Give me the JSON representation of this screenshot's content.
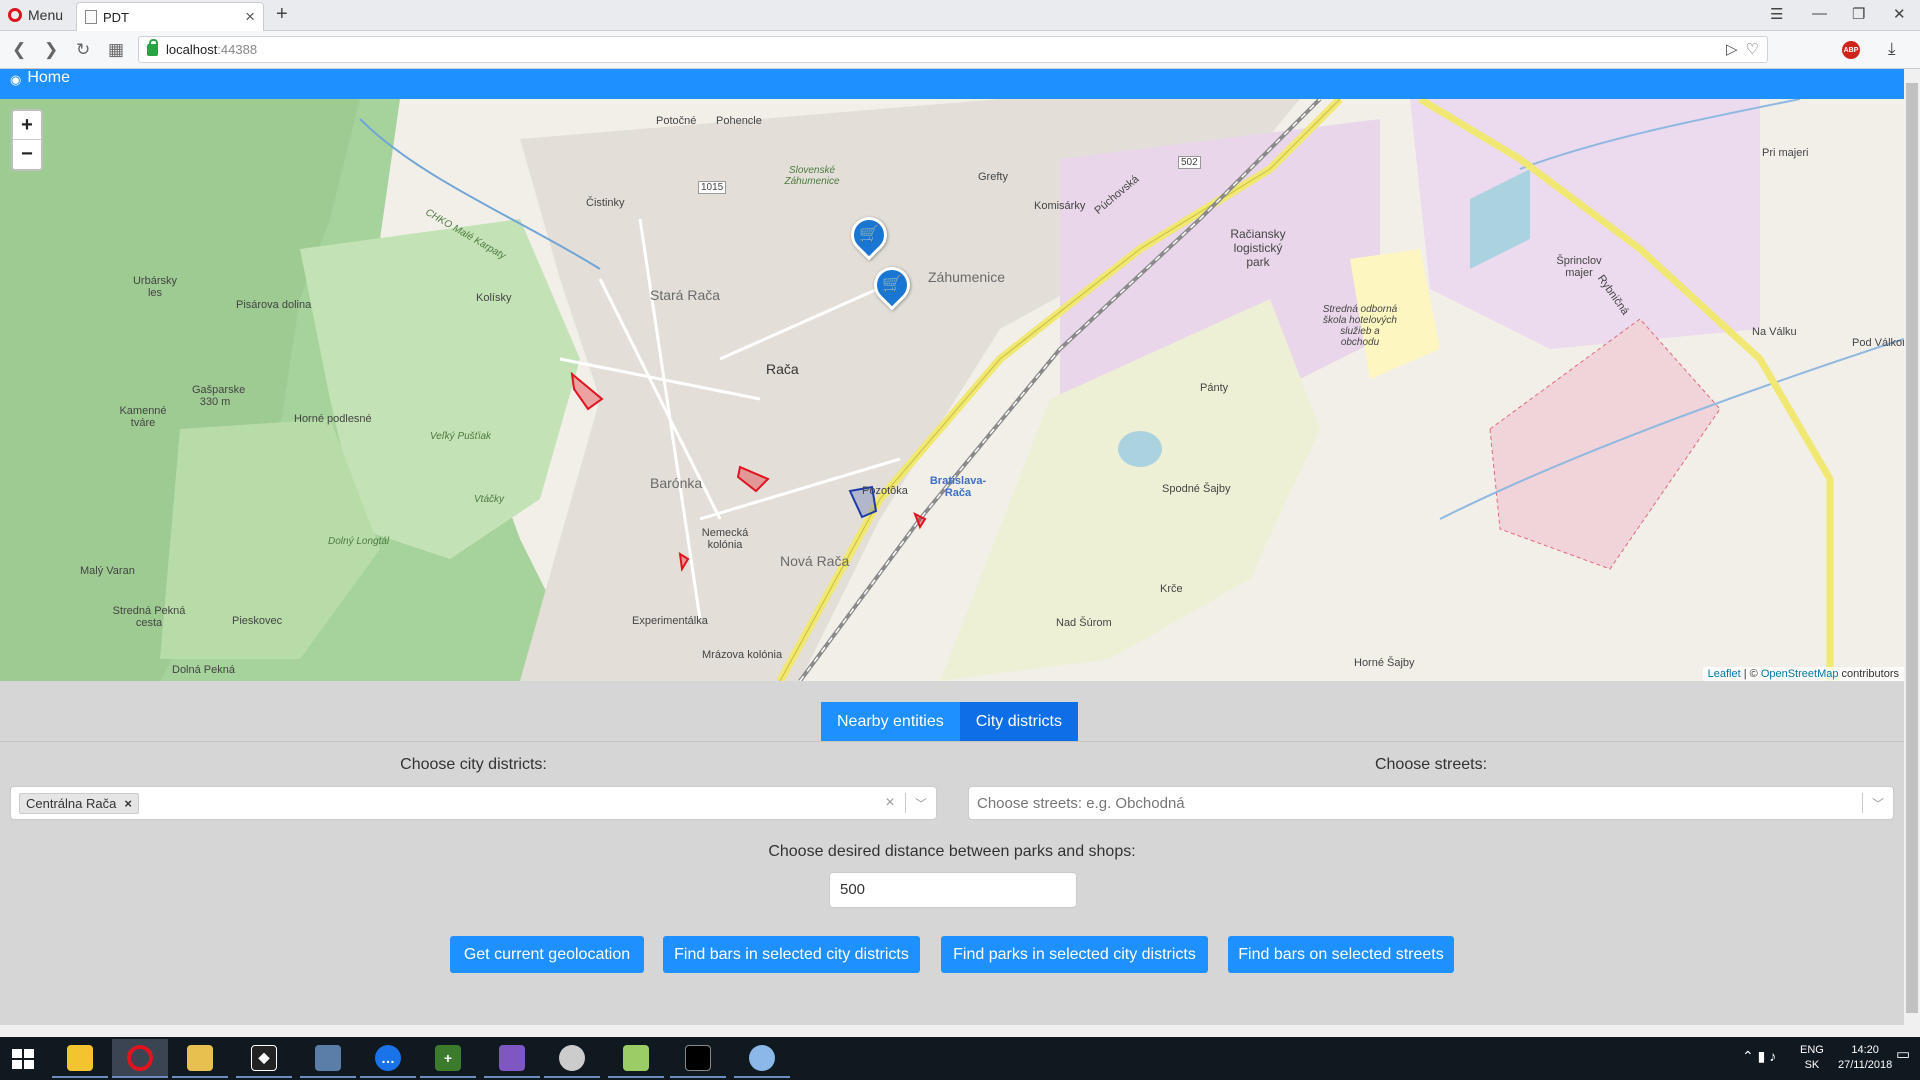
{
  "browser": {
    "menu_label": "Menu",
    "tab_title": "PDT",
    "url_host": "localhost",
    "url_port": ":44388",
    "abp_label": "ABP"
  },
  "app": {
    "home_label": "Home"
  },
  "map": {
    "zoom_in": "+",
    "zoom_out": "−",
    "attribution": {
      "leaflet": "Leaflet",
      "sep": " | © ",
      "osm": "OpenStreetMap",
      "suffix": " contributors"
    },
    "labels": {
      "raca": "Rača",
      "stara_raca": "Stará Rača",
      "baronka": "Barónka",
      "nova_raca": "Nová Rača",
      "zahumenice": "Záhumenice",
      "bratislava_raca": "Bratislava-Rača",
      "pozotoka": "Pozotôka",
      "kolisky": "Kolísky",
      "urbarsky_les": "Urbársky les",
      "pisarova_dolina": "Pisárova dolina",
      "gasparske": "Gašparske 330 m",
      "kamenne_tvare": "Kamenné tváre",
      "horne_podlesne": "Horné podlesné",
      "maly_varan": "Malý Varan",
      "stredna_pekna_cesta": "Stredná Pekná cesta",
      "pieskovec": "Pieskovec",
      "dolna_pekna": "Dolná Pekná",
      "vtacky": "Vtáčky",
      "velky_pustiak": "Veľký Pušťiak",
      "dolny_longtal": "Dolný Longtál",
      "potocne": "Potočné",
      "pohencle": "Pohencle",
      "cistinky": "Čistinky",
      "grefty": "Grefty",
      "komisarky": "Komisárky",
      "pantý": "Pánty",
      "spodne_sajby": "Spodné Šajby",
      "krce": "Krče",
      "nad_surom": "Nad Šúrom",
      "horne_sajby": "Horné Šajby",
      "pri_majeri": "Pri majeri",
      "sprinclov_majer": "Šprinclov majer",
      "na_valku": "Na Válku",
      "pod_valkom": "Pod Válkom",
      "racianky_park": "Račiansky logistický park",
      "stredna_skola": "Stredná odborná škola hotelových služieb a obchodu",
      "experimentalka": "Experimentálka",
      "mrazova_kolonia": "Mrázova kolónia",
      "nemecka_kolonia": "Nemecká kolónia",
      "puchovska": "Púchovská",
      "rybnicna": "Rybničná",
      "road_502": "502",
      "road_1015": "1015",
      "chko": "CHKO Malé Karpaty",
      "slovenske_zahumenice": "Slovenské Záhumenice"
    },
    "marker_icon": "shopping-cart-icon",
    "colors": {
      "highlight_red": "#e0141e",
      "highlight_blue": "#1e3ca8",
      "marker": "#1976d2"
    }
  },
  "tabs": [
    {
      "label": "Nearby entities",
      "active": false
    },
    {
      "label": "City districts",
      "active": true
    }
  ],
  "districts": {
    "label": "Choose city districts:",
    "selected": [
      "Centrálna Rača"
    ],
    "clear_icon": "×",
    "chip_remove": "×"
  },
  "streets": {
    "label": "Choose streets:",
    "placeholder": "Choose streets: e.g. Obchodná"
  },
  "distance": {
    "label": "Choose desired distance between parks and shops:",
    "value": "500"
  },
  "buttons": [
    "Get current geolocation",
    "Find bars in selected city districts",
    "Find parks in selected city districts",
    "Find bars on selected streets"
  ],
  "taskbar": {
    "tray_lang": "ENG",
    "tray_region": "SK",
    "time": "14:20",
    "date": "27/11/2018"
  }
}
